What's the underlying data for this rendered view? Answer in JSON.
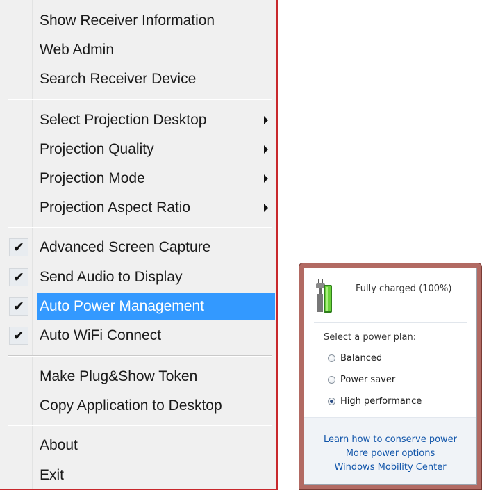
{
  "context_menu": {
    "items": [
      {
        "label": "Show Receiver Information"
      },
      {
        "label": "Web Admin"
      },
      {
        "label": "Search Receiver Device"
      },
      {
        "label": "Select Projection Desktop"
      },
      {
        "label": "Projection Quality"
      },
      {
        "label": "Projection Mode"
      },
      {
        "label": "Projection Aspect Ratio"
      },
      {
        "label": "Advanced Screen Capture",
        "checked": true
      },
      {
        "label": "Send Audio to Display",
        "checked": true
      },
      {
        "label": "Auto Power Management",
        "checked": true,
        "selected": true
      },
      {
        "label": "Auto WiFi Connect",
        "checked": true
      },
      {
        "label": "Make Plug&Show Token"
      },
      {
        "label": "Copy Application to Desktop"
      },
      {
        "label": "About"
      },
      {
        "label": "Exit"
      }
    ],
    "check_glyph": "✔",
    "highlight_color": "#3399ff"
  },
  "power_flyout": {
    "status": "Fully charged (100%)",
    "battery_level": 100,
    "battery_icon": "battery-plugged-icon",
    "plan_title": "Select a power plan:",
    "plans": [
      {
        "label": "Balanced",
        "selected": false
      },
      {
        "label": "Power saver",
        "selected": false
      },
      {
        "label": "High performance",
        "selected": true
      }
    ],
    "links": [
      {
        "label": "Learn how to conserve power"
      },
      {
        "label": "More power options"
      },
      {
        "label": "Windows Mobility Center"
      }
    ],
    "frame_color": "#b26a63"
  }
}
